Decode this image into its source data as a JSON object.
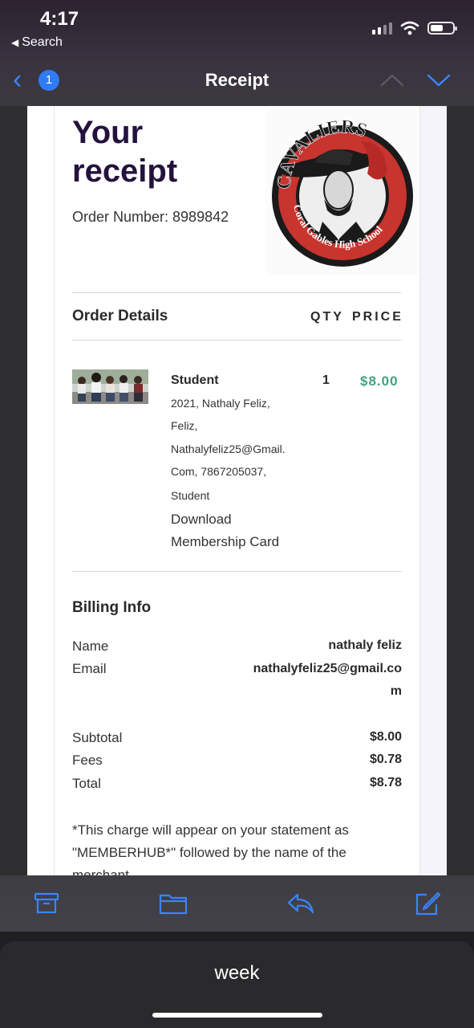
{
  "status_bar": {
    "time": "4:17",
    "back_app": "Search"
  },
  "nav": {
    "badge_count": "1",
    "title": "Receipt"
  },
  "receipt": {
    "title_line1": "Your",
    "title_line2": "receipt",
    "order_number": "Order Number: 8989842",
    "logo_text_top": "CAVALIERS",
    "logo_text_bottom": "Coral Gables High School"
  },
  "order_details": {
    "title": "Order Details",
    "qty_header": "QTY",
    "price_header": "PRICE",
    "item": {
      "name": "Student",
      "qty": "1",
      "price": "$8.00",
      "details": [
        "2021, Nathaly Feliz,",
        "Feliz,",
        "Nathalyfeliz25@Gmail.",
        "Com, 7867205037,",
        "Student"
      ],
      "link_line1": "Download",
      "link_line2": "Membership Card"
    }
  },
  "billing": {
    "title": "Billing Info",
    "name_label": "Name",
    "name_value": "nathaly feliz",
    "email_label": "Email",
    "email_value_line1": "nathalyfeliz25@gmail.co",
    "email_value_line2": "m",
    "subtotal_label": "Subtotal",
    "subtotal_value": "$8.00",
    "fees_label": "Fees",
    "fees_value": "$0.78",
    "total_label": "Total",
    "total_value": "$8.78",
    "note": "*This charge will appear on your statement as \"MEMBERHUB*\" followed by the name of the merchant."
  },
  "toolbar": {
    "icons": [
      "archive-icon",
      "folder-icon",
      "reply-icon",
      "compose-icon"
    ],
    "accent": "#3a84ff"
  },
  "bottom_sheet": {
    "text": "week"
  },
  "colors": {
    "title": "#24123d",
    "price": "#41a47c",
    "ios_blue": "#3a84ff"
  }
}
